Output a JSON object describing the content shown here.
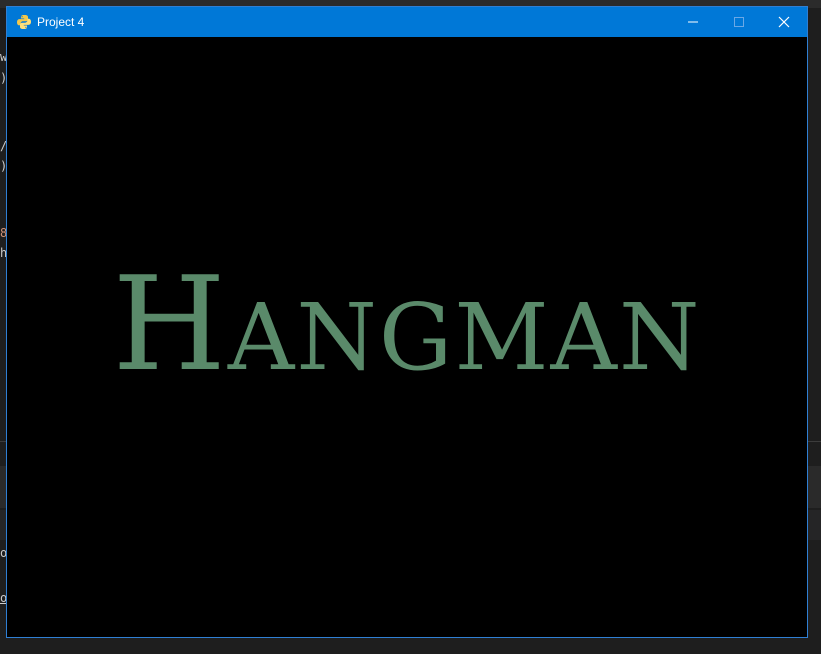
{
  "window": {
    "title": "Project 4",
    "icon": "python-icon",
    "controls": {
      "minimize": "minimize-icon",
      "maximize": "maximize-icon",
      "close": "close-icon"
    },
    "titlebar_color": "#0078d7",
    "border_color": "#2f7fd4"
  },
  "game": {
    "title_first": "H",
    "title_rest": "ANGMAN",
    "title_color": "#5a8a6a",
    "background_color": "#000000"
  },
  "background_editor": {
    "fragments": [
      "w",
      ")",
      "/",
      ")",
      "8",
      "h",
      "or",
      "or"
    ]
  }
}
